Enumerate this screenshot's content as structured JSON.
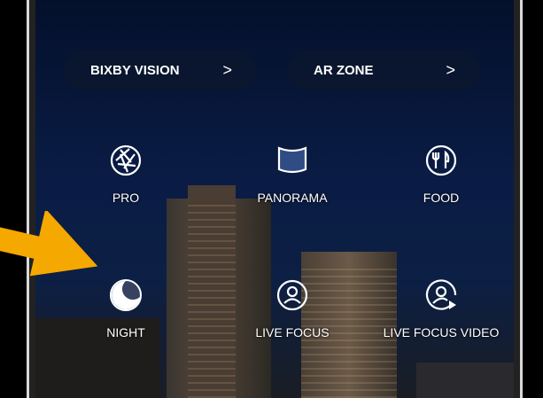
{
  "shortcuts": [
    {
      "label": "BIXBY VISION",
      "chevron": ">"
    },
    {
      "label": "AR ZONE",
      "chevron": ">"
    }
  ],
  "modes": [
    {
      "label": "PRO",
      "icon": "aperture-icon"
    },
    {
      "label": "PANORAMA",
      "icon": "panorama-icon"
    },
    {
      "label": "FOOD",
      "icon": "fork-knife-icon"
    },
    {
      "label": "NIGHT",
      "icon": "moon-icon"
    },
    {
      "label": "LIVE FOCUS",
      "icon": "person-circle-icon"
    },
    {
      "label": "LIVE FOCUS VIDEO",
      "icon": "person-video-icon"
    }
  ],
  "annotation": {
    "arrow_color": "#f5a800"
  }
}
